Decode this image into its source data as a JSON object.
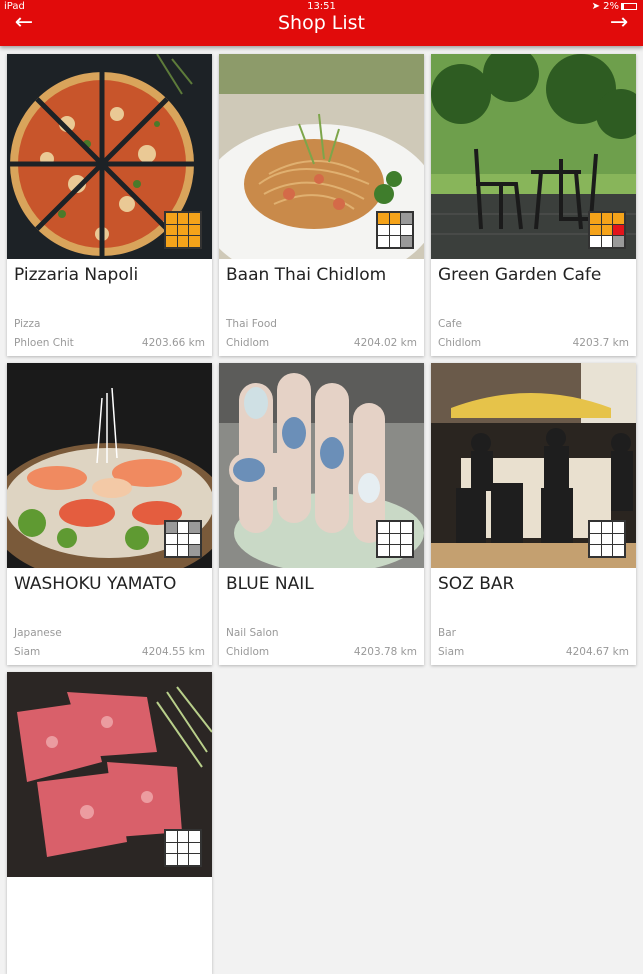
{
  "status_bar": {
    "carrier": "iPad",
    "time": "13:51",
    "battery": "2%"
  },
  "nav": {
    "title": "Shop List",
    "back_icon": "arrow-left-icon",
    "forward_icon": "arrow-right-icon"
  },
  "shops": [
    {
      "name": "Pizzaria Napoli",
      "category": "Pizza",
      "area": "Phloen Chit",
      "distance": "4203.66 km",
      "badge": [
        "o",
        "o",
        "o",
        "o",
        "o",
        "o",
        "o",
        "o",
        "o"
      ]
    },
    {
      "name": "Baan Thai Chidlom",
      "category": "Thai Food",
      "area": "Chidlom",
      "distance": "4204.02 km",
      "badge": [
        "o",
        "o",
        "g",
        "w",
        "w",
        "w",
        "w",
        "w",
        "g"
      ]
    },
    {
      "name": "Green Garden Cafe",
      "category": "Cafe",
      "area": "Chidlom",
      "distance": "4203.7 km",
      "badge": [
        "o",
        "o",
        "o",
        "o",
        "o",
        "r",
        "w",
        "w",
        "g"
      ]
    },
    {
      "name": "WASHOKU YAMATO",
      "category": "Japanese",
      "area": "Siam",
      "distance": "4204.55 km",
      "badge": [
        "g",
        "w",
        "g",
        "w",
        "w",
        "w",
        "w",
        "w",
        "g"
      ]
    },
    {
      "name": "BLUE NAIL",
      "category": "Nail Salon",
      "area": "Chidlom",
      "distance": "4203.78 km",
      "badge": [
        "w",
        "w",
        "w",
        "w",
        "w",
        "w",
        "w",
        "w",
        "w"
      ]
    },
    {
      "name": "SOZ BAR",
      "category": "Bar",
      "area": "Siam",
      "distance": "4204.67 km",
      "badge": [
        "w",
        "w",
        "w",
        "w",
        "w",
        "w",
        "w",
        "w",
        "w"
      ]
    },
    {
      "name": "",
      "category": "",
      "area": "",
      "distance": "",
      "badge": [
        "w",
        "w",
        "w",
        "w",
        "w",
        "w",
        "w",
        "w",
        "w"
      ]
    }
  ],
  "colors": {
    "nav_bar": "#e10b0b",
    "badge_orange": "#f5a31a",
    "badge_red": "#e3141b",
    "badge_gray": "#9a9a9a"
  }
}
